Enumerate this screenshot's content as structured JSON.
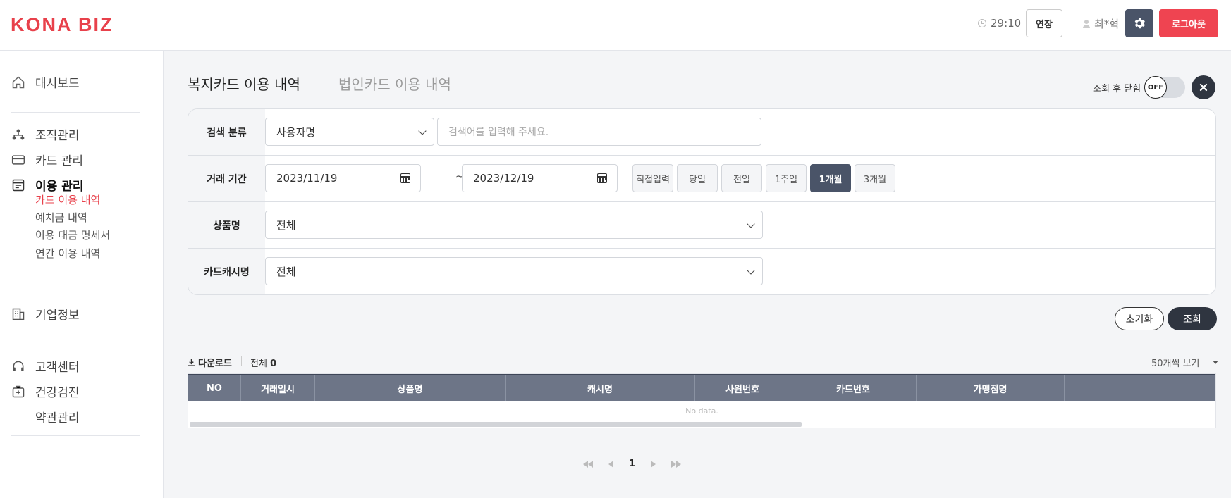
{
  "header": {
    "logo": "KONA BIZ",
    "timer": "29:10",
    "extend_label": "연장",
    "user_name": "최*혁",
    "logout_label": "로그아웃"
  },
  "sidebar": {
    "dashboard": "대시보드",
    "org": "조직관리",
    "card_mgmt": "카드 관리",
    "usage_mgmt": "이용 관리",
    "sub_items": [
      "카드 이용 내역",
      "예치금 내역",
      "이용 대금 명세서",
      "연간 이용 내역"
    ],
    "company": "기업정보",
    "support": "고객센터",
    "health": "건강검진",
    "terms": "약관관리"
  },
  "tabs": {
    "welfare": "복지카드 이용 내역",
    "corporate": "법인카드 이용 내역"
  },
  "close_toggle": {
    "label": "조회 후 닫힘",
    "state": "OFF"
  },
  "filter": {
    "search_label": "검색 분류",
    "search_type": "사용자명",
    "search_placeholder": "검색어를 입력해 주세요.",
    "period_label": "거래 기간",
    "date_from": "2023/11/19",
    "date_separator": "~",
    "date_to": "2023/12/19",
    "period_buttons": [
      "직접입력",
      "당일",
      "전일",
      "1주일",
      "1개월",
      "3개월"
    ],
    "active_period": "1개월",
    "product_label": "상품명",
    "product_value": "전체",
    "cash_label": "카드캐시명",
    "cash_value": "전체"
  },
  "actions": {
    "reset": "초기화",
    "search": "조회"
  },
  "list": {
    "download": "다운로드",
    "total_label": "전체",
    "total_count": "0",
    "per_page": "50개씩 보기",
    "columns": [
      "NO",
      "거래일시",
      "상품명",
      "캐시명",
      "사원번호",
      "카드번호",
      "가맹점명",
      ""
    ],
    "empty_text": "No data."
  },
  "pagination": {
    "current_page": "1"
  },
  "colors": {
    "brand": "#e8414b",
    "dark": "#2f3540",
    "slate": "#4a5468",
    "table_header": "#6d7587"
  }
}
